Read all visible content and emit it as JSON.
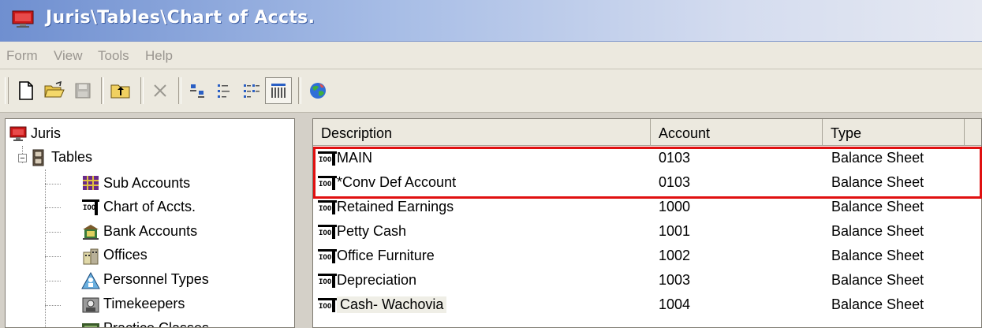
{
  "window": {
    "title": "Juris\\Tables\\Chart of Accts."
  },
  "menu": {
    "items": [
      "Form",
      "View",
      "Tools",
      "Help"
    ]
  },
  "toolbar": {
    "buttons": [
      "new-document-icon",
      "open-folder-icon",
      "save-icon",
      "up-folder-icon",
      "delete-icon",
      "large-icons-view-icon",
      "small-icons-view-icon",
      "list-view-icon",
      "details-view-icon",
      "web-globe-icon"
    ]
  },
  "tree": {
    "root": "Juris",
    "tables": "Tables",
    "items": [
      "Sub Accounts",
      "Chart of Accts.",
      "Bank Accounts",
      "Offices",
      "Personnel Types",
      "Timekeepers",
      "Practice Classes"
    ]
  },
  "list": {
    "columns": [
      "Description",
      "Account",
      "Type"
    ],
    "rows": [
      {
        "description": "MAIN",
        "account": "0103",
        "type": "Balance Sheet"
      },
      {
        "description": "*Conv Def Account",
        "account": "0103",
        "type": "Balance Sheet"
      },
      {
        "description": "Retained Earnings",
        "account": "1000",
        "type": "Balance Sheet"
      },
      {
        "description": "Petty Cash",
        "account": "1001",
        "type": "Balance Sheet"
      },
      {
        "description": "Office Furniture",
        "account": "1002",
        "type": "Balance Sheet"
      },
      {
        "description": "Depreciation",
        "account": "1003",
        "type": "Balance Sheet"
      },
      {
        "description": "Cash- Wachovia",
        "account": "1004",
        "type": "Balance Sheet"
      }
    ]
  },
  "colors": {
    "highlight": "#e01010",
    "titlebar": "#6f8fd0"
  }
}
